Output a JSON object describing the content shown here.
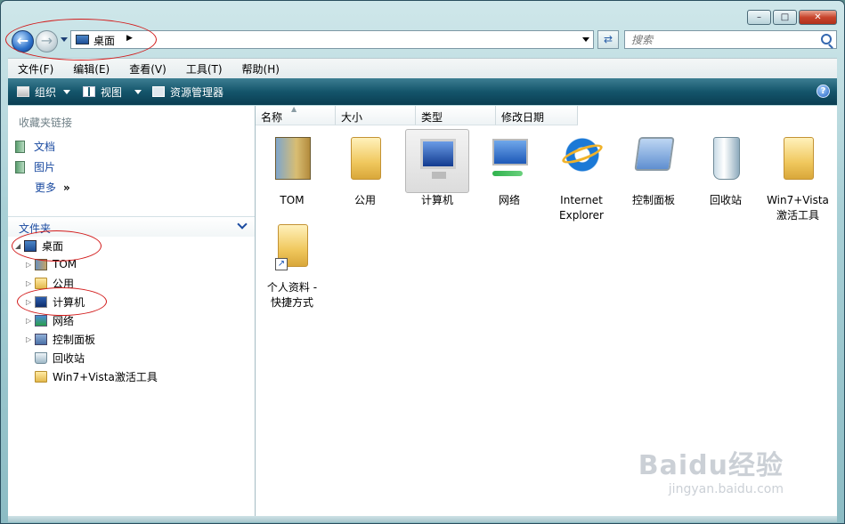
{
  "address": {
    "location": "桌面",
    "search_placeholder": "搜索"
  },
  "menubar": [
    "文件(F)",
    "编辑(E)",
    "查看(V)",
    "工具(T)",
    "帮助(H)"
  ],
  "toolbar": {
    "organize": "组织",
    "views": "视图",
    "explorer": "资源管理器"
  },
  "favorites": {
    "header": "收藏夹链接",
    "items": [
      "文档",
      "图片",
      "更多"
    ]
  },
  "folders": {
    "header": "文件夹",
    "tree": [
      "桌面",
      "TOM",
      "公用",
      "计算机",
      "网络",
      "控制面板",
      "回收站",
      "Win7+Vista激活工具"
    ]
  },
  "columns": [
    "名称",
    "大小",
    "类型",
    "修改日期"
  ],
  "items": [
    {
      "line1": "TOM",
      "line2": "",
      "icon": "user-folder-icon"
    },
    {
      "line1": "公用",
      "line2": "",
      "icon": "folder-icon"
    },
    {
      "line1": "计算机",
      "line2": "",
      "icon": "computer-icon"
    },
    {
      "line1": "网络",
      "line2": "",
      "icon": "network-icon"
    },
    {
      "line1": "Internet",
      "line2": "Explorer",
      "icon": "internet-explorer-icon"
    },
    {
      "line1": "控制面板",
      "line2": "",
      "icon": "control-panel-icon"
    },
    {
      "line1": "回收站",
      "line2": "",
      "icon": "recycle-bin-icon"
    },
    {
      "line1": "Win7+Vista",
      "line2": "激活工具",
      "icon": "folder-icon"
    },
    {
      "line1": "个人资料 -",
      "line2": "快捷方式",
      "icon": "folder-shortcut-icon"
    }
  ],
  "watermark": {
    "brand": "Baidu经验",
    "url": "jingyan.baidu.com"
  },
  "colors": {
    "toolbar": "#14556b",
    "link": "#1a4aa0",
    "annotation": "#d21a1a"
  }
}
